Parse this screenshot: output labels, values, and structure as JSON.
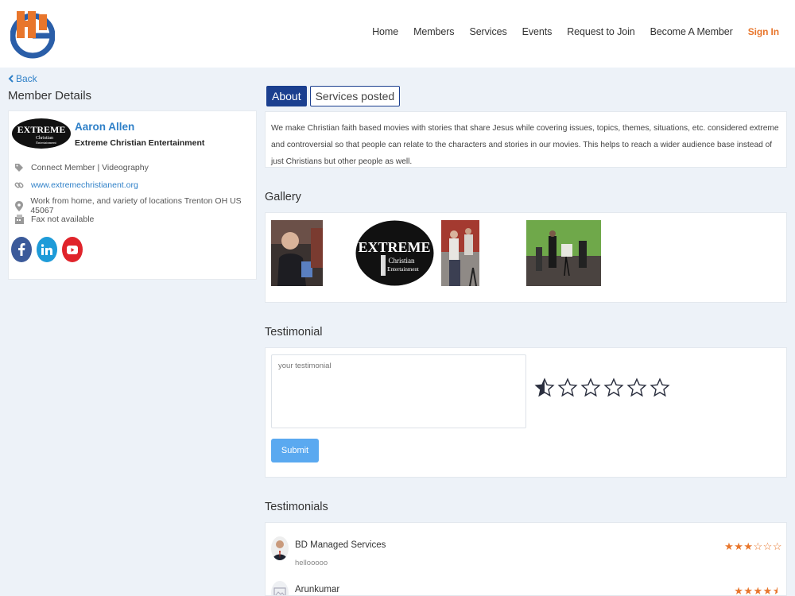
{
  "header": {
    "nav": [
      "Home",
      "Members",
      "Services",
      "Events",
      "Request to Join",
      "Become A Member"
    ],
    "signin": "Sign In"
  },
  "back": "Back",
  "member_details_title": "Member Details",
  "member": {
    "name": "Aaron Allen",
    "company": "Extreme Christian Entertainment",
    "category": "Connect Member | Videography",
    "website": "www.extremechristianent.org",
    "location": "Work from home, and variety of locations Trenton OH US 45067",
    "fax": "Fax not available",
    "logo_text": [
      "EXTREME",
      "Christian",
      "Entertainment"
    ]
  },
  "tabs": {
    "about": "About",
    "services": "Services posted"
  },
  "about_text": "We make Christian faith based movies with stories that share Jesus while covering issues, topics, themes, situations, etc. considered extreme and controversial so that people can relate to the characters and stories in our movies. This helps to reach a wider audience base instead of just Christians but other people as well.",
  "gallery_title": "Gallery",
  "testimonial_title": "Testimonial",
  "testimonial_form": {
    "placeholder": "your testimonial",
    "submit": "Submit",
    "rating": 0.5,
    "stars_total": 6
  },
  "testimonials_title": "Testimonials",
  "testimonials": [
    {
      "name": "BD Managed Services",
      "text": "hellooooo",
      "rating": 3
    },
    {
      "name": "Arunkumar",
      "text": "",
      "rating": 4.5
    }
  ],
  "colors": {
    "accent": "#e8762c",
    "link": "#2f80c8",
    "tab_active": "#1b3f8f",
    "submit": "#5aa9f0"
  }
}
